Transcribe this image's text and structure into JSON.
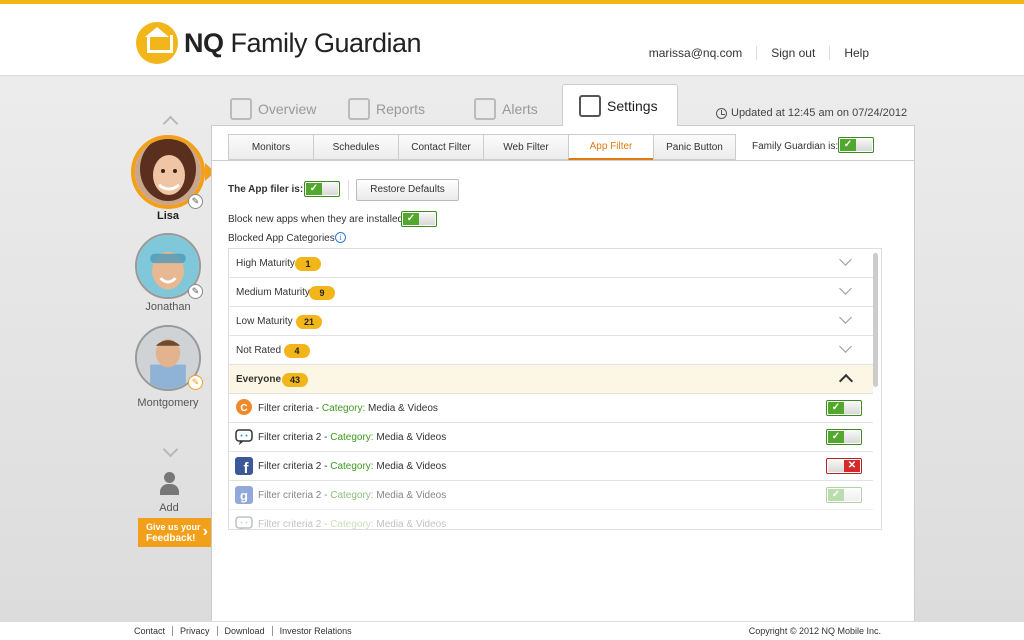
{
  "header": {
    "brand_bold": "NQ",
    "brand_rest": " Family Guardian",
    "user_email": "marissa@nq.com",
    "sign_out": "Sign out",
    "help": "Help"
  },
  "main_tabs": [
    {
      "label": "Overview",
      "icon": "overview-icon"
    },
    {
      "label": "Reports",
      "icon": "calendar-clock-icon"
    },
    {
      "label": "Alerts",
      "icon": "alert-icon"
    },
    {
      "label": "Settings",
      "icon": "settings-gear-icon"
    }
  ],
  "updated_text": "Updated at 12:45 am on 07/24/2012",
  "sub_tabs": [
    {
      "label": "Monitors"
    },
    {
      "label": "Schedules"
    },
    {
      "label": "Contact Filter"
    },
    {
      "label": "Web Filter"
    },
    {
      "label": "App Filter"
    },
    {
      "label": "Panic Button"
    }
  ],
  "family_guardian_label": "Family Guardian is:",
  "app_filter": {
    "filter_label": "The App filer is:",
    "restore_button": "Restore Defaults",
    "block_new_label": "Block new apps when they are installed:",
    "blocked_categories_label": "Blocked App Categories"
  },
  "categories": [
    {
      "name": "High Maturity",
      "count": "1"
    },
    {
      "name": "Medium Maturity",
      "count": "9"
    },
    {
      "name": "Low Maturity",
      "count": "21"
    },
    {
      "name": "Not Rated",
      "count": "4"
    },
    {
      "name": "Everyone",
      "count": "43"
    }
  ],
  "apps": [
    {
      "prefix": "Filter criteria - ",
      "cat_label": "Category:",
      "category": " Media & Videos",
      "icon": "orange-chat-app-icon",
      "state": "on"
    },
    {
      "prefix": "Filter criteria 2 - ",
      "cat_label": "Category:",
      "category": " Media & Videos",
      "icon": "messenger-app-icon",
      "state": "on"
    },
    {
      "prefix": "Filter criteria 2 - ",
      "cat_label": "Category:",
      "category": " Media & Videos",
      "icon": "facebook-app-icon",
      "state": "off"
    },
    {
      "prefix": "Filter criteria 2  - ",
      "cat_label": "Category:",
      "category": " Media & Videos",
      "icon": "google-app-icon",
      "state": "on"
    },
    {
      "prefix": "Filter criteria 2  - ",
      "cat_label": "Category:",
      "category": " Media & Videos",
      "icon": "messenger-app-icon",
      "state": "on"
    }
  ],
  "profiles": [
    {
      "name": "Lisa"
    },
    {
      "name": "Jonathan"
    },
    {
      "name": "Montgomery"
    }
  ],
  "add_label": "Add",
  "feedback": {
    "line1": "Give us your",
    "line2": "Feedback!",
    "arrow": "›"
  },
  "footer": {
    "links": [
      "Contact",
      "Privacy",
      "Download",
      "Investor Relations"
    ],
    "copyright": "Copyright © 2012 NQ Mobile Inc."
  },
  "colors": {
    "accent": "#f2b51a",
    "active_tab": "#e07b10",
    "on": "#52a82c",
    "off": "#d42a2a"
  }
}
